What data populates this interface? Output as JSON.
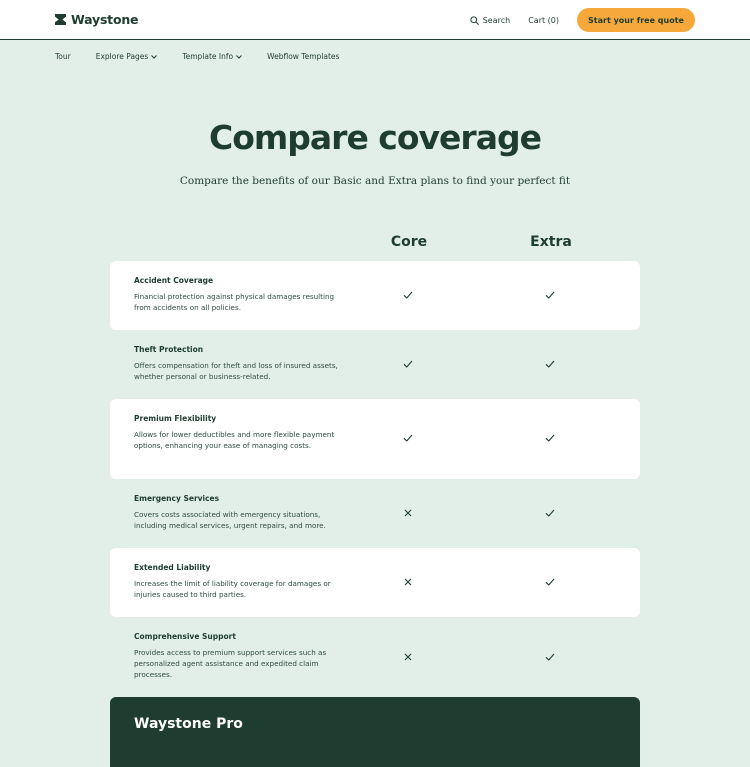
{
  "header": {
    "brand": "Waystone",
    "search_label": "Search",
    "cart_label": "Cart (0)",
    "cta_label": "Start your free quote"
  },
  "subnav": {
    "items": [
      {
        "label": "Tour",
        "dropdown": false
      },
      {
        "label": "Explore Pages",
        "dropdown": true
      },
      {
        "label": "Template Info",
        "dropdown": true
      },
      {
        "label": "Webflow Templates",
        "dropdown": false
      }
    ]
  },
  "hero": {
    "title": "Compare coverage",
    "subtitle": "Compare the benefits of our Basic and Extra plans to find your perfect fit"
  },
  "table": {
    "columns": [
      "Core",
      "Extra"
    ],
    "rows": [
      {
        "title": "Accident Coverage",
        "description": "Financial protection against physical damages resulting from accidents on all policies.",
        "core": "check",
        "extra": "check"
      },
      {
        "title": "Theft Protection",
        "description": "Offers compensation for theft and loss of insured assets, whether personal or business-related.",
        "core": "check",
        "extra": "check"
      },
      {
        "title": "Premium Flexibility",
        "description": "Allows for lower deductibles and more flexible payment options, enhancing your ease of managing costs.",
        "core": "check",
        "extra": "check"
      },
      {
        "title": "Emergency Services",
        "description": "Covers costs associated with emergency situations, including medical services, urgent repairs, and more.",
        "core": "cross",
        "extra": "check"
      },
      {
        "title": "Extended Liability",
        "description": "Increases the limit of liability coverage for damages or injuries caused to third parties.",
        "core": "cross",
        "extra": "check"
      },
      {
        "title": "Comprehensive Support",
        "description": "Provides access to premium support services such as personalized agent assistance and expedited claim processes.",
        "core": "cross",
        "extra": "check"
      }
    ]
  },
  "pro": {
    "title": "Waystone Pro"
  },
  "colors": {
    "background": "#e2efe9",
    "dark_green": "#1e3c2f",
    "accent": "#f6a93a",
    "card": "#ffffff"
  },
  "icons": {
    "logo": "hourglass-logo-icon",
    "search": "search-icon",
    "dropdown": "chevron-down-icon",
    "included": "check-icon",
    "excluded": "cross-icon"
  }
}
